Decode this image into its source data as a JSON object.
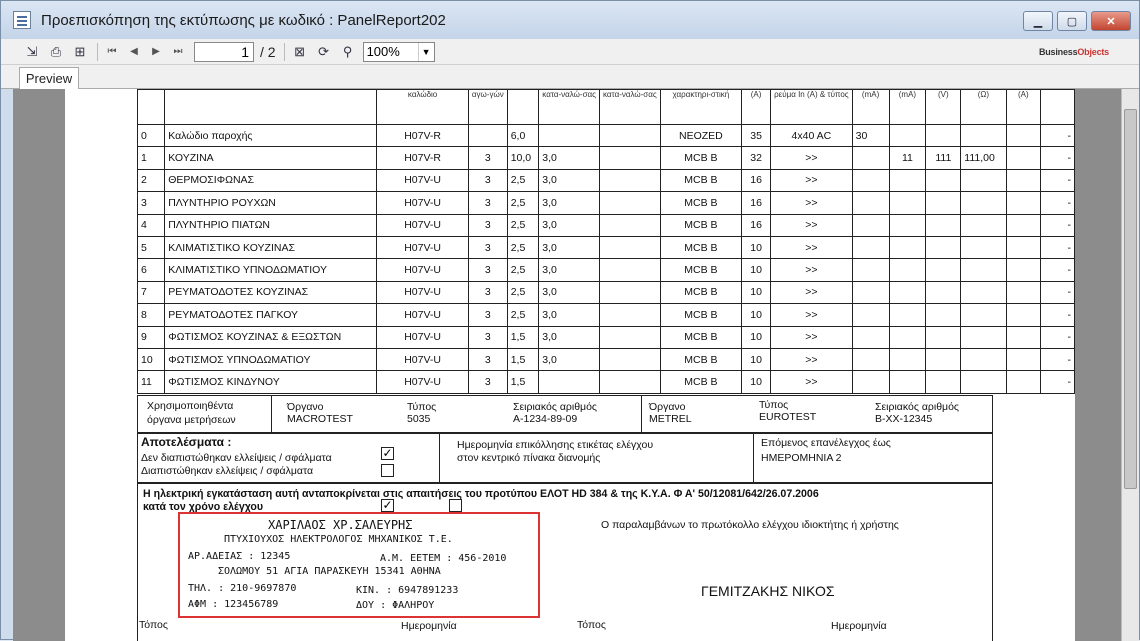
{
  "window": {
    "title": "Προεπισκόπηση της εκτύπωσης με κωδικό : PanelReport202"
  },
  "toolbar": {
    "current_page": "1",
    "page_total": "/ 2",
    "zoom": "100%",
    "brand": {
      "pre": "Business",
      "post": "Objects"
    }
  },
  "tabs": {
    "preview": "Preview"
  },
  "table": {
    "header": [
      "",
      "",
      "καλώδιο",
      "αγω-γών",
      "",
      "κατα-ναλώ-σας",
      "κατα-ναλώ-σας",
      "χαρακτηρι-στική",
      "(A)",
      "ρεύμα In (A) & τύπος",
      "(mA)",
      "(mA)",
      "(V)",
      "(Ω)",
      "(A)",
      ""
    ],
    "rows": [
      [
        "0",
        "Καλώδιο παροχής",
        "H07V-R",
        "",
        "6,0",
        "",
        "",
        "NEOZED",
        "35",
        "4x40 AC",
        "30",
        "",
        "",
        "",
        "",
        "-"
      ],
      [
        "1",
        "ΚΟΥΖΙΝΑ",
        "H07V-R",
        "3",
        "10,0",
        "3,0",
        "",
        "MCB B",
        "32",
        ">>",
        "",
        "11",
        "111",
        "111,00",
        "",
        "-"
      ],
      [
        "2",
        "ΘΕΡΜΟΣΙΦΩΝΑΣ",
        "H07V-U",
        "3",
        "2,5",
        "3,0",
        "",
        "MCB B",
        "16",
        ">>",
        "",
        "",
        "",
        "",
        "",
        "-"
      ],
      [
        "3",
        "ΠΛΥΝΤΗΡΙΟ ΡΟΥΧΩΝ",
        "H07V-U",
        "3",
        "2,5",
        "3,0",
        "",
        "MCB B",
        "16",
        ">>",
        "",
        "",
        "",
        "",
        "",
        "-"
      ],
      [
        "4",
        "ΠΛΥΝΤΗΡΙΟ ΠΙΑΤΩΝ",
        "H07V-U",
        "3",
        "2,5",
        "3,0",
        "",
        "MCB B",
        "16",
        ">>",
        "",
        "",
        "",
        "",
        "",
        "-"
      ],
      [
        "5",
        "ΚΛΙΜΑΤΙΣΤΙΚΟ ΚΟΥΖΙΝΑΣ",
        "H07V-U",
        "3",
        "2,5",
        "3,0",
        "",
        "MCB B",
        "10",
        ">>",
        "",
        "",
        "",
        "",
        "",
        "-"
      ],
      [
        "6",
        "ΚΛΙΜΑΤΙΣΤΙΚΟ ΥΠΝΟΔΩΜΑΤΙΟΥ",
        "H07V-U",
        "3",
        "2,5",
        "3,0",
        "",
        "MCB B",
        "10",
        ">>",
        "",
        "",
        "",
        "",
        "",
        "-"
      ],
      [
        "7",
        "ΡΕΥΜΑΤΟΔΟΤΕΣ ΚΟΥΖΙΝΑΣ",
        "H07V-U",
        "3",
        "2,5",
        "3,0",
        "",
        "MCB B",
        "10",
        ">>",
        "",
        "",
        "",
        "",
        "",
        "-"
      ],
      [
        "8",
        "ΡΕΥΜΑΤΟΔΟΤΕΣ ΠΑΓΚΟΥ",
        "H07V-U",
        "3",
        "2,5",
        "3,0",
        "",
        "MCB B",
        "10",
        ">>",
        "",
        "",
        "",
        "",
        "",
        "-"
      ],
      [
        "9",
        "ΦΩΤΙΣΜΟΣ ΚΟΥΖΙΝΑΣ & ΕΞΩΣΤΩΝ",
        "H07V-U",
        "3",
        "1,5",
        "3,0",
        "",
        "MCB B",
        "10",
        ">>",
        "",
        "",
        "",
        "",
        "",
        "-"
      ],
      [
        "10",
        "ΦΩΤΙΣΜΟΣ ΥΠΝΟΔΩΜΑΤΙΟΥ",
        "H07V-U",
        "3",
        "1,5",
        "3,0",
        "",
        "MCB B",
        "10",
        ">>",
        "",
        "",
        "",
        "",
        "",
        "-"
      ],
      [
        "11",
        "ΦΩΤΙΣΜΟΣ ΚΙΝΔΥΝΟΥ",
        "H07V-U",
        "3",
        "1,5",
        "",
        "",
        "MCB B",
        "10",
        ">>",
        "",
        "",
        "",
        "",
        "",
        "-"
      ]
    ]
  },
  "instruments": {
    "label_line1": "Χρησιμοποιηθέντα",
    "label_line2": "όργανα μετρήσεων",
    "inst1": {
      "organo_label": "Όργανο",
      "organo": "MACROTEST",
      "typos_label": "Τύπος",
      "typos": "5035",
      "serial_label": "Σειριακός αριθμός",
      "serial": "A-1234-89-09"
    },
    "inst2": {
      "organo_label": "Όργανο",
      "organo": "METREL",
      "typos_label": "Τύπος",
      "typos": "EUROTEST",
      "serial_label": "Σειριακός αριθμός",
      "serial": "B-XX-12345"
    }
  },
  "results": {
    "title": "Αποτελέσματα :",
    "no_faults": "Δεν διαπιστώθηκαν ελλείψεις / σφάλματα",
    "faults": "Διαπιστώθηκαν ελλείψεις / σφάλματα",
    "label_date_line1": "Ημερομηνία επικόλλησης ετικέτας ελέγχου",
    "label_date_line2": "στον κεντρικό πίνακα διανομής",
    "next_check_label": "Επόμενος επανέλεγχος έως",
    "next_check_value": "ΗΜΕΡΟΜΗΝΙΑ 2"
  },
  "compliance": {
    "line1": "Η ηλεκτρική εγκατάσταση αυτή ανταποκρίνεται στις απαιτήσεις του προτύπου ΕΛΟΤ HD 384 & της Κ.Υ.Α. Φ Α' 50/12081/642/26.07.2006",
    "line2": "κατά τον χρόνο ελέγχου"
  },
  "stamp": {
    "name": "ΧΑΡΙΛΑΟΣ ΧΡ.ΣΑΛΕΥΡΗΣ",
    "title": "ΠΤΥΧΙΟΥΧΟΣ ΗΛΕΚΤΡΟΛΟΓΟΣ ΜΗΧΑΝΙΚΟΣ Τ.Ε.",
    "license": "ΑΡ.ΑΔΕΙΑΣ : 12345",
    "am": "Α.Μ. ΕΕΤΕΜ : 456-2010",
    "address": "ΣΟΛΩΜΟΥ 51 ΑΓΙΑ ΠΑΡΑΣΚΕΥΗ 15341 ΑΘΗΝΑ",
    "phone": "ΤΗΛ. : 210-9697870",
    "mobile": "ΚΙΝ. : 6947891233",
    "afm": "ΑΦΜ : 123456789",
    "doy": "ΔΟΥ : ΦΑΛΗΡΟΥ"
  },
  "signature": {
    "owner_text": "Ο παραλαμβάνων το πρωτόκολλο ελέγχου ιδιοκτήτης ή χρήστης",
    "owner_name": "ΓΕΜΙΤΖΑΚΗΣ ΝΙΚΟΣ"
  },
  "footer": {
    "place1": "Τόπος",
    "date1": "Ημερομηνία",
    "place2": "Τόπος",
    "date2": "Ημερομηνία"
  }
}
